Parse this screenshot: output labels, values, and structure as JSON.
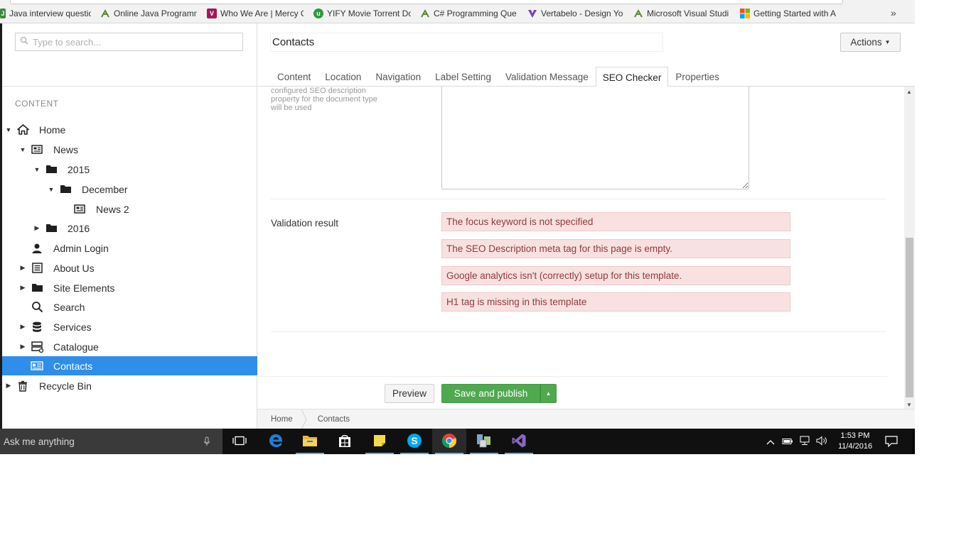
{
  "browser": {
    "bookmarks": [
      {
        "label": "Java interview questio",
        "icon": "java-icon",
        "color": "#3b8a3b"
      },
      {
        "label": "Online Java Programm",
        "icon": "tree-icon",
        "color": "#5a8a2f"
      },
      {
        "label": "Who We Are | Mercy C",
        "icon": "mercy-icon",
        "color": "#a0195a"
      },
      {
        "label": "YIFY Movie Torrent Do",
        "icon": "yify-icon",
        "color": "#2e9a3e"
      },
      {
        "label": "C# Programming Que",
        "icon": "tree-icon",
        "color": "#5a8a2f"
      },
      {
        "label": "Vertabelo - Design Yo",
        "icon": "vertabelo-icon",
        "color": "#7a3fb5"
      },
      {
        "label": "Microsoft Visual Studi",
        "icon": "tree-icon",
        "color": "#5a8a2f"
      },
      {
        "label": "Getting Started with A",
        "icon": "windows-icon",
        "color": "#f25022"
      }
    ],
    "more_label": "»"
  },
  "sidebar": {
    "search_placeholder": "Type to search...",
    "section_title": "CONTENT",
    "tree": [
      {
        "label": "Home",
        "icon": "home-icon",
        "caret": "open",
        "indent": 0
      },
      {
        "label": "News",
        "icon": "news-icon",
        "caret": "open",
        "indent": 1
      },
      {
        "label": "2015",
        "icon": "folder-icon",
        "caret": "open",
        "indent": 2
      },
      {
        "label": "December",
        "icon": "folder-icon",
        "caret": "open",
        "indent": 3
      },
      {
        "label": "News 2",
        "icon": "news-icon",
        "caret": "none",
        "indent": 4
      },
      {
        "label": "2016",
        "icon": "folder-icon",
        "caret": "closed",
        "indent": 2
      },
      {
        "label": "Admin Login",
        "icon": "user-icon",
        "caret": "none",
        "indent": 1
      },
      {
        "label": "About Us",
        "icon": "document-icon",
        "caret": "closed",
        "indent": 1
      },
      {
        "label": "Site Elements",
        "icon": "folder-icon",
        "caret": "closed",
        "indent": 1
      },
      {
        "label": "Search",
        "icon": "search-icon",
        "caret": "none",
        "indent": 1
      },
      {
        "label": "Services",
        "icon": "database-icon",
        "caret": "closed",
        "indent": 1
      },
      {
        "label": "Catalogue",
        "icon": "catalogue-icon",
        "caret": "closed",
        "indent": 1
      },
      {
        "label": "Contacts",
        "icon": "contact-card-icon",
        "caret": "none",
        "indent": 1,
        "selected": true
      },
      {
        "label": "Recycle Bin",
        "icon": "trash-icon",
        "caret": "closed",
        "indent": 0
      }
    ]
  },
  "header": {
    "node_name": "Contacts",
    "actions_label": "Actions",
    "tabs": [
      {
        "label": "Content",
        "active": false
      },
      {
        "label": "Location",
        "active": false
      },
      {
        "label": "Navigation",
        "active": false
      },
      {
        "label": "Label Setting",
        "active": false
      },
      {
        "label": "Validation Message",
        "active": false
      },
      {
        "label": "SEO Checker",
        "active": true
      },
      {
        "label": "Properties",
        "active": false
      }
    ]
  },
  "seo": {
    "description_hint": "configured SEO description property for the document type will be used",
    "validation_label": "Validation result",
    "messages": [
      "The focus keyword is not specified",
      "The SEO Description meta tag for this page is empty.",
      "Google analytics isn't (correctly) setup for this template.",
      "H1 tag is missing in this template"
    ]
  },
  "footer": {
    "preview_label": "Preview",
    "publish_label": "Save and publish"
  },
  "breadcrumb": [
    "Home",
    "Contacts"
  ],
  "taskbar": {
    "search_placeholder": "Ask me anything",
    "time": "1:53 PM",
    "date": "11/4/2016"
  },
  "colors": {
    "selected": "#2e8ee9",
    "publish": "#50a84f",
    "error_bg": "#f9e1e1",
    "error_text": "#8e3b3b"
  }
}
